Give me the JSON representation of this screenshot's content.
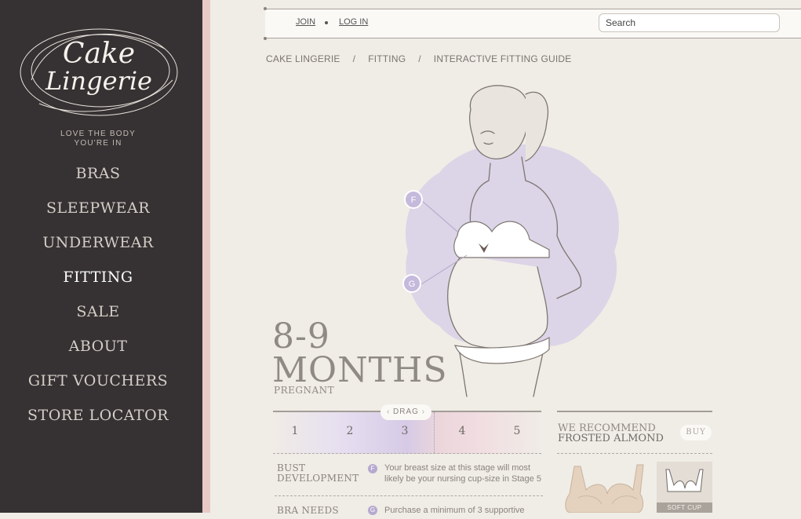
{
  "brand": {
    "logo_text": "Cake Lingerie",
    "tagline": "LOVE THE BODY\nYOU'RE IN"
  },
  "nav": {
    "items": [
      {
        "label": "BRAS"
      },
      {
        "label": "SLEEPWEAR"
      },
      {
        "label": "UNDERWEAR"
      },
      {
        "label": "FITTING",
        "active": true
      },
      {
        "label": "SALE"
      },
      {
        "label": "ABOUT"
      },
      {
        "label": "GIFT VOUCHERS"
      },
      {
        "label": "STORE LOCATOR"
      }
    ]
  },
  "topbar": {
    "join_label": "JOIN",
    "login_label": "LOG IN",
    "search_placeholder": "Search"
  },
  "breadcrumb": {
    "items": [
      "CAKE LINGERIE",
      "FITTING",
      "INTERACTIVE FITTING GUIDE"
    ],
    "separator": "/"
  },
  "figure": {
    "markers": [
      "F",
      "G"
    ]
  },
  "stage": {
    "range": "8-9",
    "unit": "MONTHS",
    "subtitle": "PREGNANT"
  },
  "slider": {
    "steps": [
      "1",
      "2",
      "3",
      "4",
      "5"
    ],
    "current_step": 3,
    "drag_label": "DRAG"
  },
  "info": [
    {
      "label": "BUST\nDEVELOPMENT",
      "badge": "F",
      "text": "Your breast size at this stage will most likely be your nursing cup-size in Stage 5"
    },
    {
      "label": "BRA NEEDS",
      "badge": "G",
      "text": "Purchase a minimum of 3 supportive"
    }
  ],
  "recommend": {
    "heading": "WE RECOMMEND",
    "product": "FROSTED ALMOND",
    "buy_label": "BUY",
    "thumb_label": "SOFT CUP"
  },
  "colors": {
    "sidebar": "#363233",
    "accent_strip": "#e9c9c5",
    "page_bg": "#f0ece6",
    "lilac": "#d6cae6"
  }
}
